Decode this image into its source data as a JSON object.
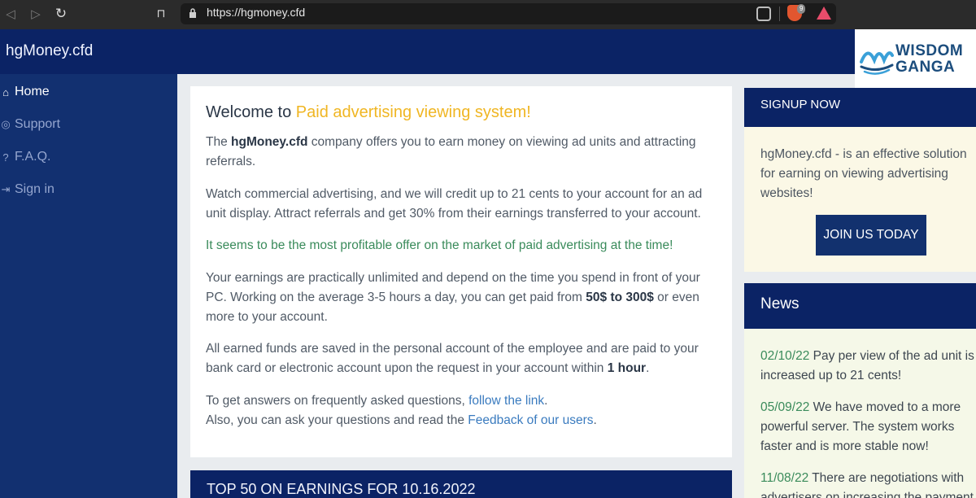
{
  "browser": {
    "url": "https://hgmoney.cfd",
    "extension_badge": "9"
  },
  "site": {
    "brand": "hgMoney.cfd"
  },
  "watermark": {
    "line1": "WISDOM",
    "line2": "GANGA"
  },
  "sidebar": {
    "items": [
      {
        "label": "Home",
        "icon": "home-icon",
        "glyph": "⌂"
      },
      {
        "label": "Support",
        "icon": "lifebuoy-icon",
        "glyph": "◎"
      },
      {
        "label": "F.A.Q.",
        "icon": "question-icon",
        "glyph": "?"
      },
      {
        "label": "Sign in",
        "icon": "sign-in-icon",
        "glyph": "⇥"
      }
    ]
  },
  "main": {
    "title_prefix": "Welcome to ",
    "title_highlight": "Paid advertising viewing system!",
    "p1_a": "The ",
    "p1_b": "hgMoney.cfd",
    "p1_c": " company offers you to earn money on viewing ad units and attracting referrals.",
    "p2": "Watch commercial advertising, and we will credit up to 21 cents to your account for an ad unit display. Attract referrals and get 30% from their earnings transferred to your account.",
    "p3": "It seems to be the most profitable offer on the market of paid advertising at the time!",
    "p4_a": "Your earnings are practically unlimited and depend on the time you spend in front of your PC. Working on the average 3-5 hours a day, you can get paid from ",
    "p4_b": "50$ to 300$",
    "p4_c": " or even more to your account.",
    "p5_a": "All earned funds are saved in the personal account of the employee and are paid to your bank card or electronic account upon the request in your account within ",
    "p5_b": "1 hour",
    "p5_c": ".",
    "p6_a": "To get answers on frequently asked questions, ",
    "p6_link": "follow the link",
    "p6_b": ".",
    "p7_a": "Also, you can ask your questions and read the ",
    "p7_link": "Feedback of our users",
    "p7_b": "."
  },
  "top_earnings": {
    "title": "TOP 50 ON EARNINGS FOR 10.16.2022"
  },
  "signup": {
    "heading": "SIGNUP NOW",
    "description": "hgMoney.cfd - is an effective solution for earning on viewing advertising websites!",
    "button": "JOIN US TODAY"
  },
  "news": {
    "heading": "News",
    "items": [
      {
        "date": "02/10/22",
        "text": " Pay per view of the ad unit is increased up to 21 cents!"
      },
      {
        "date": "05/09/22",
        "text": " We have moved to a more powerful server. The system works faster and is more stable now!"
      },
      {
        "date": "11/08/22",
        "text": " There are negotiations with advertisers on increasing the payment"
      }
    ]
  },
  "colors": {
    "navy": "#0b2365",
    "sidebar": "#123070",
    "accent_yellow": "#f0b623",
    "green_text": "#3a8b5b",
    "link": "#3a7bbf"
  }
}
